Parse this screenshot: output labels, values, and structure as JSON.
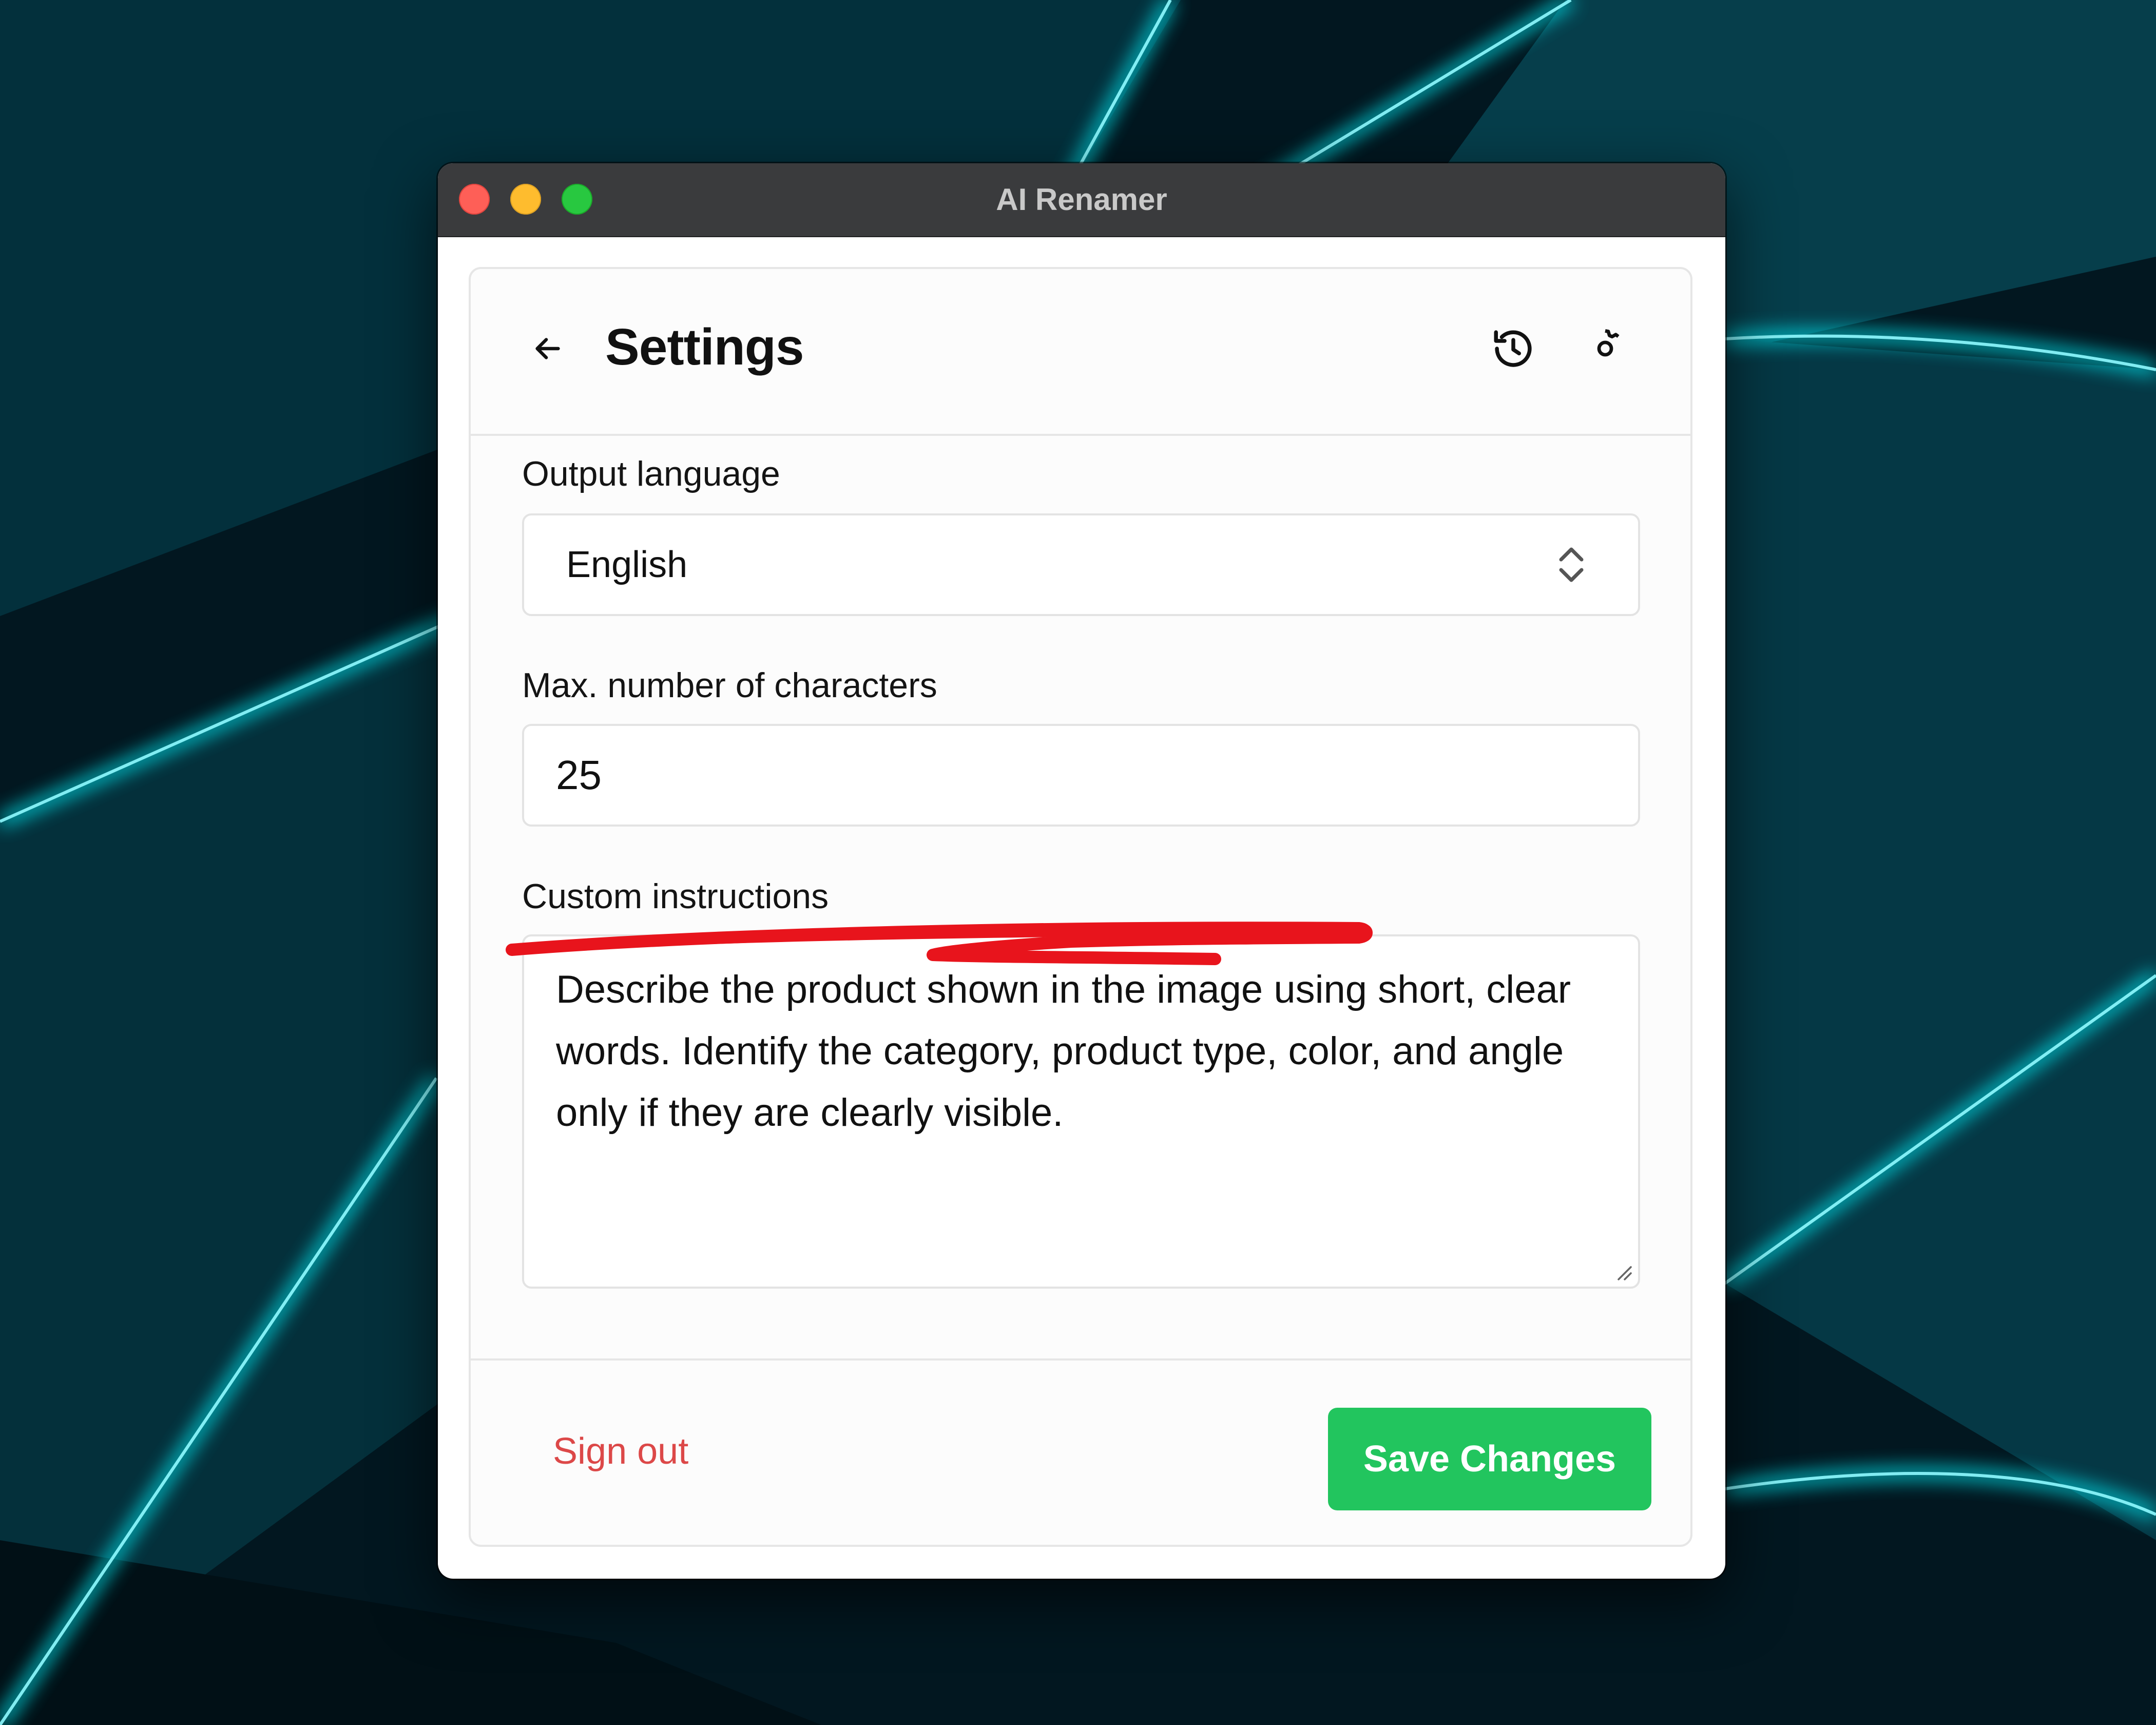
{
  "window": {
    "title": "AI Renamer"
  },
  "header": {
    "title": "Settings",
    "back_icon": "arrow-left-icon",
    "history_icon": "history-icon",
    "settings_icon": "gear-icon"
  },
  "fields": {
    "output_language": {
      "label": "Output language",
      "value": "English"
    },
    "max_chars": {
      "label": "Max. number of characters",
      "value": "25"
    },
    "custom_instructions": {
      "label": "Custom instructions",
      "value": "Describe the product shown in the image using short, clear words. Identify the category, product type, color, and angle only if they are clearly visible."
    }
  },
  "footer": {
    "sign_out_label": "Sign out",
    "save_label": "Save Changes"
  },
  "colors": {
    "accent_green": "#22c55e",
    "danger_red": "#dc4848",
    "annotation_red": "#e8141c",
    "desktop_glow": "#00e5ee"
  }
}
